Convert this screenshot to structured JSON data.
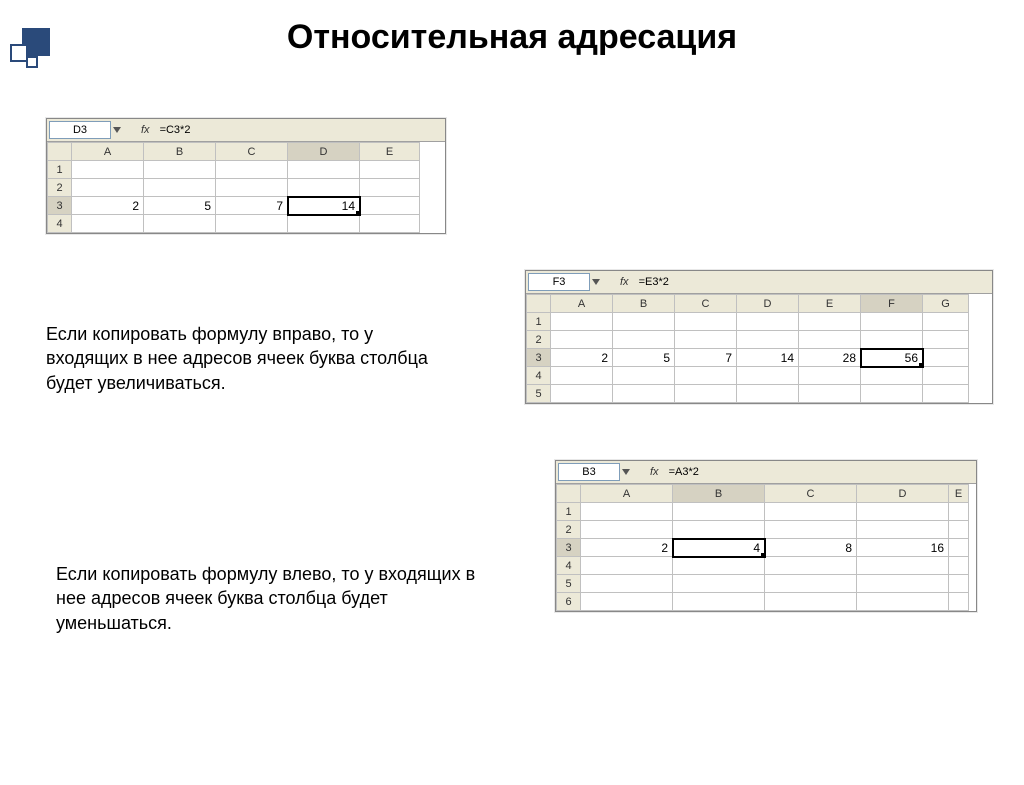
{
  "title": "Относительная адресация",
  "para1": "Если копировать формулу вправо, то у входящих в нее адресов ячеек буква столбца будет увеличиваться.",
  "para2": "Если копировать формулу влево, то у входящих в нее адресов ячеек буква столбца будет уменьшаться.",
  "sheet1": {
    "active_cell": "D3",
    "fx_label": "fx",
    "formula": "=C3*2",
    "cols": [
      "A",
      "B",
      "C",
      "D",
      "E"
    ],
    "rows": [
      "1",
      "2",
      "3",
      "4"
    ],
    "row3": {
      "A": "2",
      "B": "5",
      "C": "7",
      "D": "14"
    },
    "sel_col": "D",
    "sel_row": "3"
  },
  "sheet2": {
    "active_cell": "F3",
    "fx_label": "fx",
    "formula": "=E3*2",
    "cols": [
      "A",
      "B",
      "C",
      "D",
      "E",
      "F",
      "G"
    ],
    "rows": [
      "1",
      "2",
      "3",
      "4",
      "5"
    ],
    "row3": {
      "A": "2",
      "B": "5",
      "C": "7",
      "D": "14",
      "E": "28",
      "F": "56"
    },
    "sel_col": "F",
    "sel_row": "3"
  },
  "sheet3": {
    "active_cell": "B3",
    "fx_label": "fx",
    "formula": "=A3*2",
    "cols": [
      "A",
      "B",
      "C",
      "D"
    ],
    "rows": [
      "1",
      "2",
      "3",
      "4",
      "5",
      "6"
    ],
    "row3": {
      "A": "2",
      "B": "4",
      "C": "8",
      "D": "16"
    },
    "sel_col": "B",
    "sel_row": "3",
    "extra_col_hint": "E"
  }
}
